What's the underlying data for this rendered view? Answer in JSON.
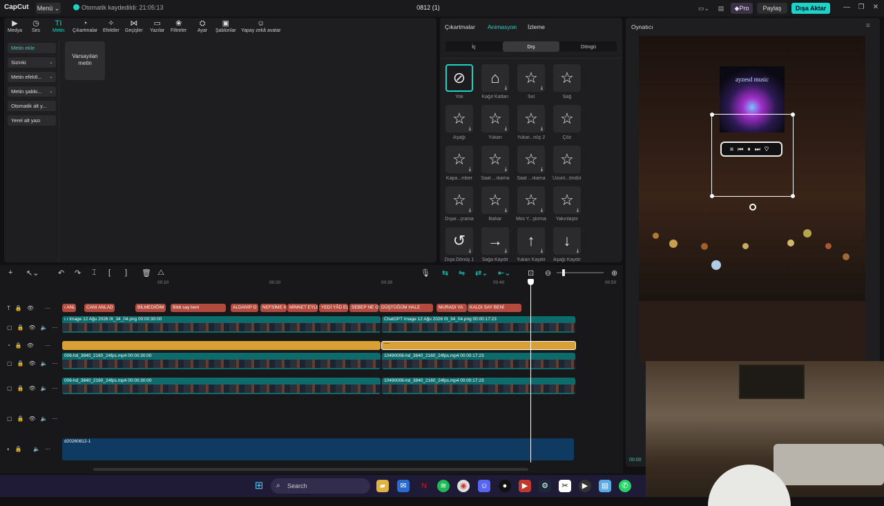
{
  "titlebar": {
    "app_name": "CapCut",
    "menu_label": "Menü ⌄",
    "autosave_text": "Otomatik kaydedildi: 21:05:13",
    "project_title": "0812 (1)",
    "pro_label": "◆Pro",
    "share_label": "Paylaş",
    "export_label": "Dışa Aktar",
    "layout_icon": "layout-icon",
    "doc_icon": "document-icon",
    "minimize": "—",
    "maximize": "❐",
    "close": "✕"
  },
  "toolbar": {
    "tools": [
      {
        "label": "Medya",
        "icon": "▶"
      },
      {
        "label": "Ses",
        "icon": "◷"
      },
      {
        "label": "Metin",
        "icon": "TI"
      },
      {
        "label": "Çıkartmalar",
        "icon": "◔"
      },
      {
        "label": "Efektler",
        "icon": "✧"
      },
      {
        "label": "Geçişler",
        "icon": "⋈"
      },
      {
        "label": "Yazılar",
        "icon": "▭"
      },
      {
        "label": "Filtreler",
        "icon": "❀"
      },
      {
        "label": "Ayar",
        "icon": "⛭"
      },
      {
        "label": "Şablonlar",
        "icon": "▣"
      },
      {
        "label": "Yapay zekâ avatar",
        "icon": "☺"
      }
    ]
  },
  "sidebar": {
    "items": [
      {
        "label": "Metin ekle"
      },
      {
        "label": "Sizinki"
      },
      {
        "label": "Metin efektl..."
      },
      {
        "label": "Metin şablo..."
      },
      {
        "label": "Otomatik alt y..."
      },
      {
        "label": "Yerel alt yazı"
      }
    ],
    "chevron": "⌄"
  },
  "main": {
    "default_text_card": "Varsayılan metin"
  },
  "anim_panel": {
    "tabs": [
      "Çıkartmalar",
      "Animasyon",
      "İzleme"
    ],
    "segments": [
      "İç",
      "Dış",
      "Döngü"
    ],
    "items": [
      {
        "label": "Yok",
        "glyph": "⊘"
      },
      {
        "label": "Kağıt Katları",
        "glyph": "⌂"
      },
      {
        "label": "Sol",
        "glyph": "☆"
      },
      {
        "label": "Sağ",
        "glyph": "☆"
      },
      {
        "label": "Aşağı",
        "glyph": "☆"
      },
      {
        "label": "Yukarı",
        "glyph": "☆"
      },
      {
        "label": "Yukar...nüş 2",
        "glyph": "☆"
      },
      {
        "label": "Çöz",
        "glyph": "☆"
      },
      {
        "label": "Kapa...mber",
        "glyph": "☆"
      },
      {
        "label": "Saat ...ıkama",
        "glyph": "☆"
      },
      {
        "label": "Saat ...ıkama",
        "glyph": "☆"
      },
      {
        "label": "Uzunl...öndür",
        "glyph": "☆"
      },
      {
        "label": "Dışar...çrama",
        "glyph": "☆"
      },
      {
        "label": "Bahar",
        "glyph": "☆"
      },
      {
        "label": "Mini Y...ştırma",
        "glyph": "☆"
      },
      {
        "label": "Yakınlaştır",
        "glyph": "☆"
      },
      {
        "label": "Dışa Dönüş 1",
        "glyph": "↺"
      },
      {
        "label": "Sağa Kaydır",
        "glyph": "→"
      },
      {
        "label": "Yukarı Kaydır",
        "glyph": "↑"
      },
      {
        "label": "Aşağı Kaydır",
        "glyph": "↓"
      }
    ],
    "download_glyph": "⤓"
  },
  "player": {
    "title": "Oynatıcı",
    "album_title": "ayzesd music",
    "controls": "≡⏮⏸⏭♡",
    "time": "00:00"
  },
  "timeline": {
    "ticks": [
      "00:10",
      "00:20",
      "00:30",
      "00:40",
      "00:50"
    ],
    "text_clips": [
      "ı ANL",
      "CANI ANLAD",
      "BİLMEDİĞİM",
      "Bildi say beni",
      "ALDANIP O",
      "NEFSİME K",
      "MİNNET EYLE",
      "YEDİ YÂD EL",
      "SEBEP NE O",
      "DÜŞTÜĞÜM HALE",
      "MURADI YA",
      "KALDI SAY BENİ"
    ],
    "video1_clips": [
      "ı ı Image 12 Ağu 2026 0t_34_04.png  00:00:30:00",
      "ChatGPT Image 12 Ağu 2026 0t_34_04.png  00:00:17:23"
    ],
    "adjust_clip_label": "~~",
    "video2_clips": [
      "006-hd_3840_2160_24fps.mp4  00:00:30:00",
      "10490006-hd_3840_2160_24fps.mp4  00:00:17:23"
    ],
    "video3_clips": [
      "006-hd_3840_2160_24fps.mp4  00:00:30:00",
      "10490006-hd_3840_2160_24fps.mp4  00:00:17:23"
    ],
    "audio_clip": "d20260812-1"
  },
  "taskbar": {
    "search_label": "Search",
    "start_icon": "⊞"
  }
}
